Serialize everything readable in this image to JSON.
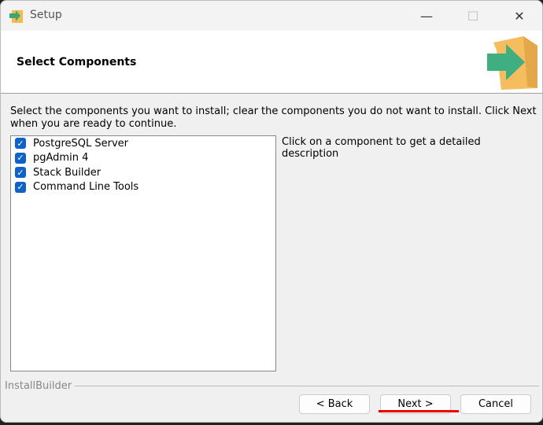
{
  "window": {
    "title": "Setup",
    "minimize": "—",
    "maximize": "☐",
    "close": "✕"
  },
  "header": {
    "title": "Select Components"
  },
  "instructions": "Select the components you want to install; clear the components you do not want to install. Click Next when you are ready to continue.",
  "components": [
    {
      "label": "PostgreSQL Server",
      "checked": true
    },
    {
      "label": "pgAdmin 4",
      "checked": true
    },
    {
      "label": "Stack Builder",
      "checked": true
    },
    {
      "label": "Command Line Tools",
      "checked": true
    }
  ],
  "check_glyph": "✓",
  "description": "Click on a component to get a detailed description",
  "footer": {
    "brand": "InstallBuilder",
    "back": "< Back",
    "next": "Next >",
    "cancel": "Cancel"
  },
  "colors": {
    "accent": "#0f62c8",
    "highlight": "#e00000"
  }
}
